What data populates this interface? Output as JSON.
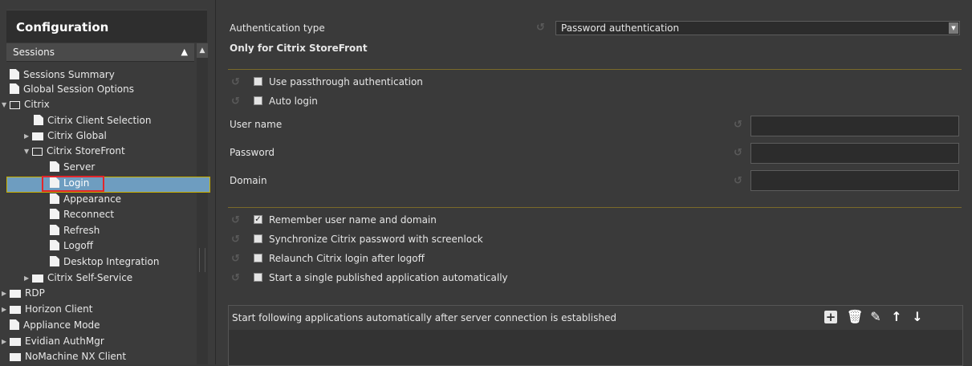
{
  "sidebar": {
    "title": "Configuration",
    "section": "Sessions",
    "items": [
      {
        "label": "Sessions Summary"
      },
      {
        "label": "Global Session Options"
      },
      {
        "label": "Citrix"
      },
      {
        "label": "Citrix Client Selection"
      },
      {
        "label": "Citrix Global"
      },
      {
        "label": "Citrix StoreFront"
      },
      {
        "label": "Server"
      },
      {
        "label": "Login"
      },
      {
        "label": "Appearance"
      },
      {
        "label": "Reconnect"
      },
      {
        "label": "Refresh"
      },
      {
        "label": "Logoff"
      },
      {
        "label": "Desktop Integration"
      },
      {
        "label": "Citrix Self-Service"
      },
      {
        "label": "RDP"
      },
      {
        "label": "Horizon Client"
      },
      {
        "label": "Appliance Mode"
      },
      {
        "label": "Evidian AuthMgr"
      },
      {
        "label": "NoMachine NX Client"
      }
    ],
    "selected": "Login"
  },
  "main": {
    "auth_type_label": "Authentication type",
    "auth_type_value": "Password authentication",
    "section_heading": "Only for Citrix StoreFront",
    "use_passthrough": {
      "label": "Use passthrough authentication",
      "checked": false
    },
    "auto_login": {
      "label": "Auto login",
      "checked": false
    },
    "user_name_label": "User name",
    "user_name_value": "",
    "password_label": "Password",
    "password_value": "",
    "domain_label": "Domain",
    "domain_value": "",
    "remember": {
      "label": "Remember user name and domain",
      "checked": true
    },
    "sync_password": {
      "label": "Synchronize Citrix password with screenlock",
      "checked": false
    },
    "relaunch": {
      "label": "Relaunch Citrix login after logoff",
      "checked": false
    },
    "single_app": {
      "label": "Start a single published application automatically",
      "checked": false
    },
    "apps_header": "Start following applications automatically after server connection is established",
    "check_mark": "✓",
    "icons": [
      "add-icon",
      "delete-icon",
      "edit-icon",
      "arrow-up-icon",
      "arrow-down-icon"
    ]
  },
  "colors": {
    "selection": "#6e9dc0",
    "selection_border": "#c8b000",
    "highlight_box": "#e2262a",
    "separator": "#7a6a2a"
  }
}
